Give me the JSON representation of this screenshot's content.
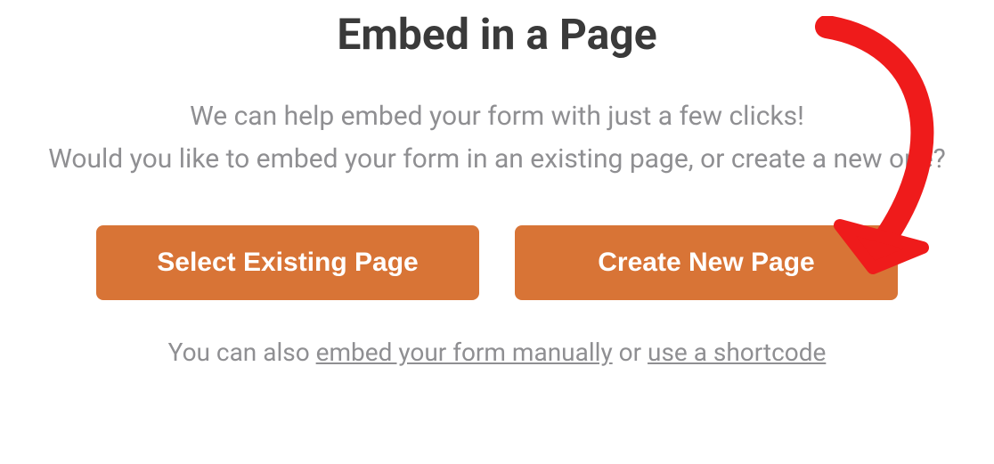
{
  "heading": "Embed in a Page",
  "description_line1": "We can help embed your form with just a few clicks!",
  "description_line2": "Would you like to embed your form in an existing page, or create a new one?",
  "buttons": {
    "select_existing": "Select Existing Page",
    "create_new": "Create New Page"
  },
  "footer": {
    "prefix": "You can also ",
    "link_manual": "embed your form manually",
    "middle": " or ",
    "link_shortcode": "use a shortcode"
  },
  "annotation": {
    "arrow_color": "#ef1b1b",
    "points_to": "create-new-page-button"
  }
}
